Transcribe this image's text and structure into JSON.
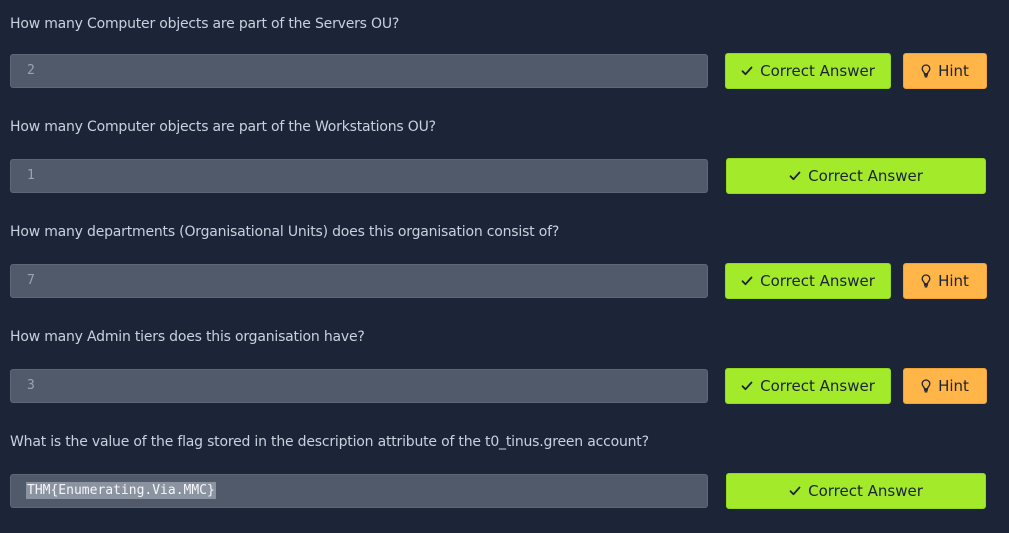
{
  "labels": {
    "correct_answer": "Correct Answer",
    "hint": "Hint"
  },
  "colors": {
    "background": "#1c2538",
    "correct_button": "#a3ea2a",
    "hint_button": "#ffb547",
    "answer_field": "#505a6a"
  },
  "icons": {
    "correct": "check-icon",
    "hint": "lightbulb-icon"
  },
  "questions": [
    {
      "text": "How many Computer objects are part of the Servers OU?",
      "answer": "2",
      "has_hint": true
    },
    {
      "text": "How many Computer objects are part of the Workstations OU?",
      "answer": "1",
      "has_hint": false
    },
    {
      "text": "How many departments (Organisational Units) does this organisation consist of?",
      "answer": "7",
      "has_hint": true
    },
    {
      "text": "How many Admin tiers does this organisation have?",
      "answer": "3",
      "has_hint": true
    },
    {
      "text": "What is the value of the flag stored in the description attribute of the t0_tinus.green account?",
      "answer": "THM{Enumerating.Via.MMC}",
      "has_hint": false,
      "answer_selected": true
    }
  ]
}
